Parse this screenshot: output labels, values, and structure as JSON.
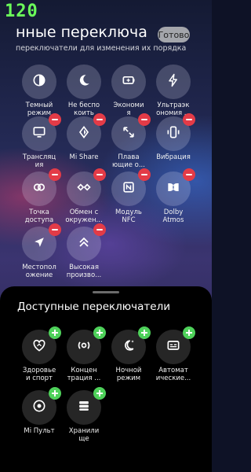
{
  "status": {
    "fps": "120"
  },
  "header": {
    "title": "нные переключа",
    "done_label": "Готово",
    "subtitle": "переключатели для изменения их порядка"
  },
  "active_tiles": [
    {
      "label": "Темный\nрежим",
      "icon": "dark-mode-icon"
    },
    {
      "label": "Не беспо\nкоить",
      "icon": "moon-icon"
    },
    {
      "label": "Экономи\nя",
      "icon": "battery-saver-icon"
    },
    {
      "label": "Ультраэк\nономия ...",
      "icon": "bolt-icon"
    },
    {
      "label": "Трансляц\nия",
      "icon": "cast-icon"
    },
    {
      "label": "Mi Share",
      "icon": "mi-share-icon"
    },
    {
      "label": "Плава\nющие о...",
      "icon": "floating-windows-icon"
    },
    {
      "label": "Вибрация",
      "icon": "vibration-icon"
    },
    {
      "label": "Точка\nдоступа",
      "icon": "hotspot-icon"
    },
    {
      "label": "Обмен с\nокружен...",
      "icon": "nearby-share-icon"
    },
    {
      "label": "Модуль\nNFC",
      "icon": "nfc-icon"
    },
    {
      "label": "Dolby\nAtmos",
      "icon": "dolby-icon"
    },
    {
      "label": "Местопол\nожение",
      "icon": "location-icon"
    },
    {
      "label": "Высокая\nпроизво...",
      "icon": "high-performance-icon"
    }
  ],
  "available": {
    "title": "Доступные переключатели",
    "tiles": [
      {
        "label": "Здоровье\nи спорт",
        "icon": "health-icon"
      },
      {
        "label": "Концен\nтрация ...",
        "icon": "focus-icon"
      },
      {
        "label": "Ночной\nрежим",
        "icon": "night-mode-icon"
      },
      {
        "label": "Автомат\nические...",
        "icon": "auto-captions-icon"
      },
      {
        "label": "Mi Пульт",
        "icon": "remote-icon"
      },
      {
        "label": "Хранили\nще",
        "icon": "storage-icon"
      }
    ]
  }
}
